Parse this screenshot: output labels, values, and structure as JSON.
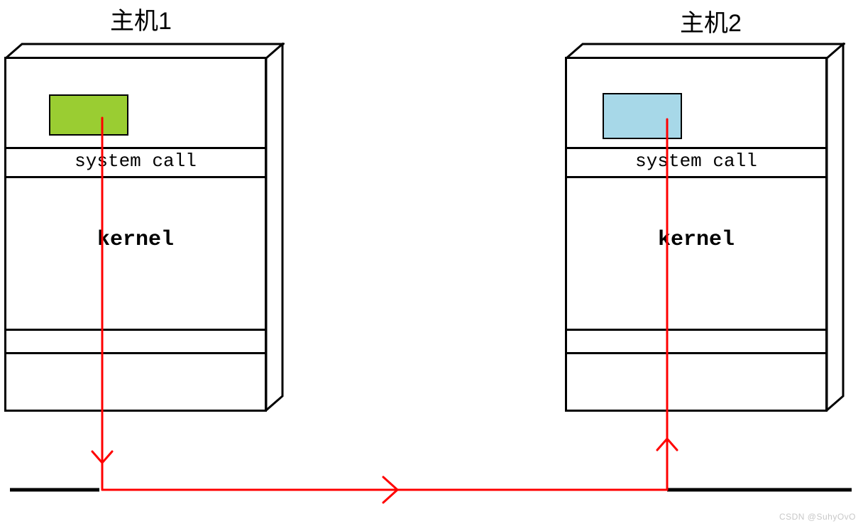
{
  "host1": {
    "title": "主机1",
    "system_call": "system call",
    "kernel": "kernel"
  },
  "host2": {
    "title": "主机2",
    "system_call": "system call",
    "kernel": "kernel"
  },
  "colors": {
    "arrow": "#ff0000",
    "chip_green": "#9acd32",
    "chip_blue": "#a7d8e8"
  },
  "watermark": "CSDN @SuhyOvO"
}
